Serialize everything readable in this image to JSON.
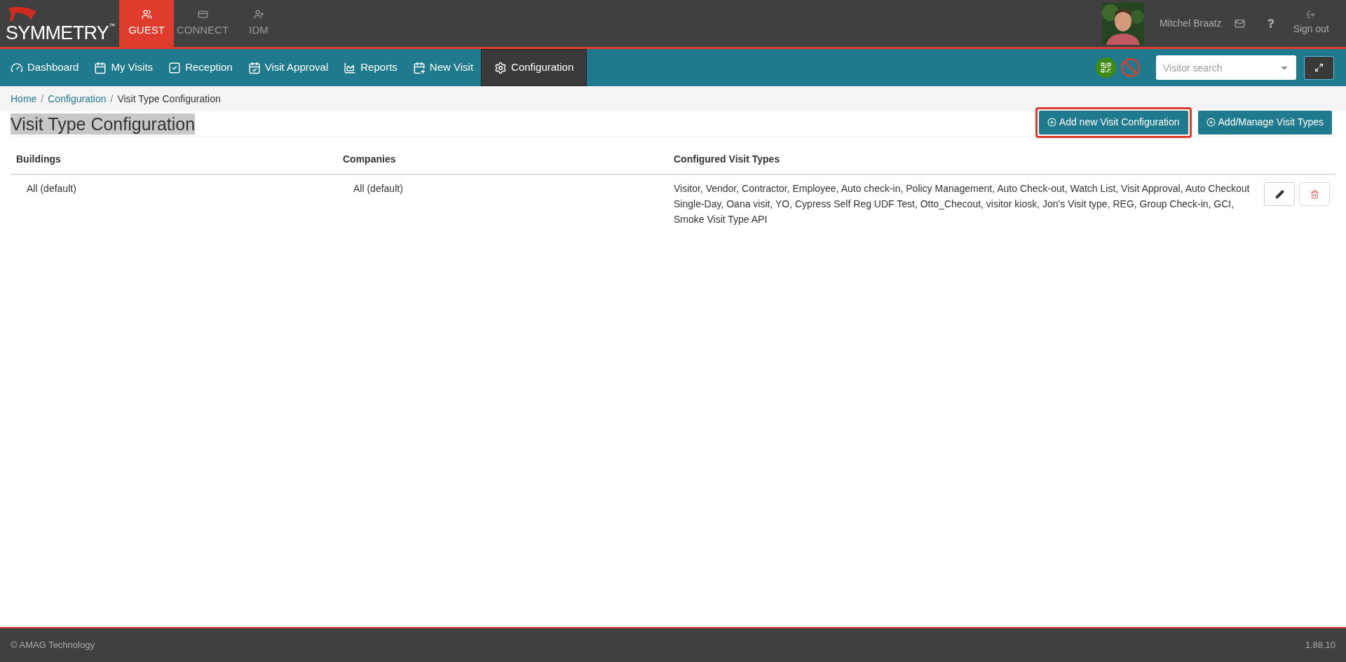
{
  "logo": {
    "text": "SYMMETRY",
    "mark": "™"
  },
  "apps": [
    {
      "label": "GUEST",
      "selected": true
    },
    {
      "label": "CONNECT",
      "selected": false
    },
    {
      "label": "IDM",
      "selected": false
    }
  ],
  "user": {
    "name": "Mitchel Braatz",
    "sign_out": "Sign out"
  },
  "nav": [
    {
      "label": "Dashboard",
      "selected": false
    },
    {
      "label": "My Visits",
      "selected": false
    },
    {
      "label": "Reception",
      "selected": false
    },
    {
      "label": "Visit Approval",
      "selected": false
    },
    {
      "label": "Reports",
      "selected": false
    },
    {
      "label": "New Visit",
      "selected": false
    },
    {
      "label": "Configuration",
      "selected": true
    }
  ],
  "search": {
    "placeholder": "Visitor search"
  },
  "breadcrumb_separator": "/",
  "breadcrumb": [
    {
      "label": "Home",
      "kind": "link"
    },
    {
      "label": "Configuration",
      "kind": "link"
    },
    {
      "label": "Visit Type Configuration",
      "kind": "current"
    }
  ],
  "title": "Visit Type Configuration",
  "actions": [
    {
      "label": "Add new Visit Configuration",
      "highlighted": true
    },
    {
      "label": "Add/Manage Visit Types",
      "highlighted": false
    }
  ],
  "table": {
    "columns": [
      "Buildings",
      "Companies",
      "Configured Visit Types"
    ],
    "rows": [
      {
        "cells": [
          "All (default)",
          "All (default)",
          "Visitor, Vendor, Contractor, Employee, Auto check-in, Policy Management, Auto Check-out, Watch List, Visit Approval, Auto Checkout Single-Day, Oana visit, YO, Cypress Self Reg UDF Test, Otto_Checout, visitor kiosk, Jon's Visit type, REG, Group Check-in, GCI, Smoke Visit Type API"
        ]
      }
    ]
  },
  "footer": {
    "copyright": "© AMAG Technology",
    "version": "1.88.10"
  }
}
